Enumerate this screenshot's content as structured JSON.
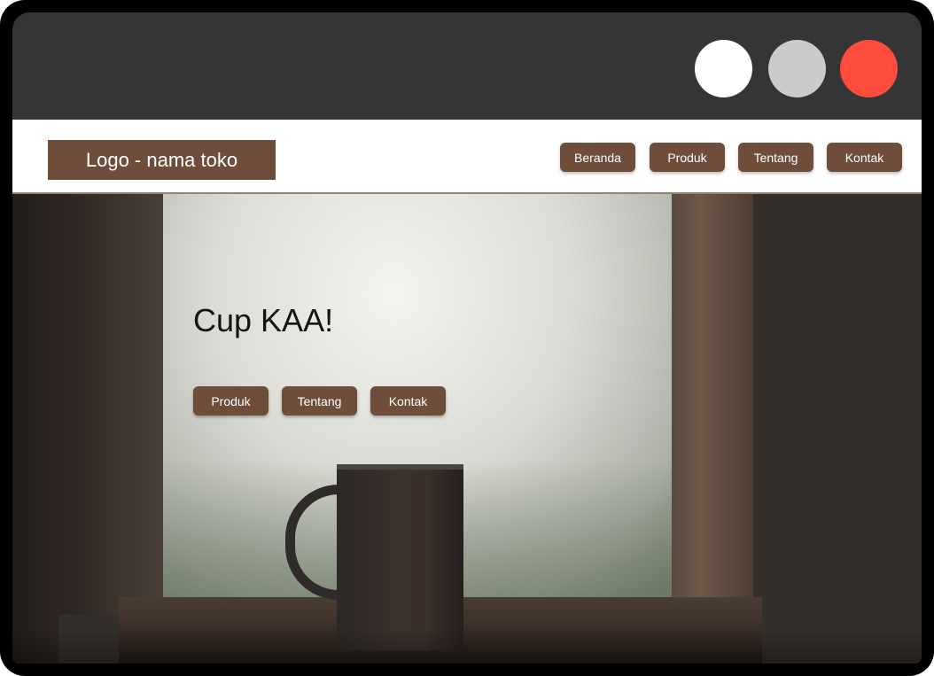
{
  "window_controls": {
    "colors": [
      "#ffffff",
      "#cbcbcb",
      "#ff4b3b"
    ]
  },
  "navbar": {
    "logo_text": "Logo - nama toko",
    "items": [
      {
        "label": "Beranda"
      },
      {
        "label": "Produk"
      },
      {
        "label": "Tentang"
      },
      {
        "label": "Kontak"
      }
    ]
  },
  "hero": {
    "title": "Cup KAA!",
    "buttons": [
      {
        "label": "Produk"
      },
      {
        "label": "Tentang"
      },
      {
        "label": "Kontak"
      }
    ]
  },
  "colors": {
    "accent": "#6e4e3a",
    "titlebar": "#353535",
    "background": "#352f2c"
  }
}
